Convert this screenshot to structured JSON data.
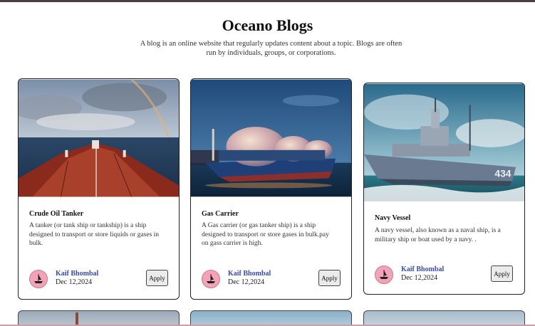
{
  "header": {
    "title": "Oceano Blogs",
    "description": "A blog is an online website that regularly updates content about a topic. Blogs are often run by individuals, groups, or corporations."
  },
  "cards": [
    {
      "title": "Crude Oil Tanker",
      "text": "A tanker (or tank ship or tankship) is a ship designed to transport or store liquids or gases in bulk.",
      "author": "Kaif Bhombal",
      "date": "Dec 12,2024",
      "button": "Apply",
      "image_icon": "oil-tanker-photo"
    },
    {
      "title": "Gas Carrier",
      "text": "A Gas carrier (or gas tanker ship) is a ship designed to transport or store gases in bulk.pay on gass carrier is high.",
      "author": "Kaif Bhombal",
      "date": "Dec 12,2024",
      "button": "Apply",
      "image_icon": "gas-carrier-photo"
    },
    {
      "title": "Navy Vessel",
      "text": "A navy vessel, also known as a naval ship, is a military ship or boat used by a navy. .",
      "author": "Kaif Bhombal",
      "date": "Dec 12,2024",
      "button": "Apply",
      "image_icon": "navy-vessel-photo"
    }
  ],
  "colors": {
    "author_link": "#3a4ab0",
    "avatar_bg": "#f2a3b8",
    "card_border": "#222222"
  }
}
